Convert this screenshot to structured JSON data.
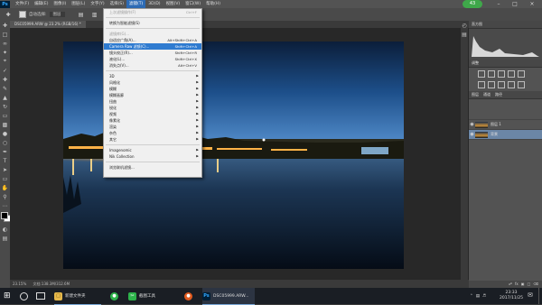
{
  "app": {
    "logo": "Ps"
  },
  "menubar": {
    "items": [
      "文件(F)",
      "编辑(E)",
      "图像(I)",
      "图层(L)",
      "文字(Y)",
      "选择(S)",
      "滤镜(T)",
      "3D(D)",
      "视图(V)",
      "窗口(W)",
      "帮助(H)"
    ],
    "active_index": 6
  },
  "optbar": {
    "auto_select_label": "自动选择:",
    "layer_value": "图层"
  },
  "document": {
    "tab": "DSC05999.ARW @ 23.2% (RGB/16) *",
    "zoom": "23.15%",
    "doc_info": "文档:138.3M/312.6M"
  },
  "badge": {
    "value": "43"
  },
  "filter_menu": {
    "items": [
      {
        "label": "上次滤镜操作(F)",
        "shortcut": "Ctrl+F",
        "disabled": true
      },
      {
        "sep": true
      },
      {
        "label": "转换为智能滤镜(S)"
      },
      {
        "sep": true
      },
      {
        "label": "滤镜库(G)...",
        "disabled": true
      },
      {
        "label": "自适应广角(A)...",
        "shortcut": "Alt+Shift+Ctrl+A"
      },
      {
        "label": "Camera Raw 滤镜(C)...",
        "shortcut": "Shift+Ctrl+A",
        "highlight": true
      },
      {
        "label": "镜头校正(R)...",
        "shortcut": "Shift+Ctrl+R"
      },
      {
        "label": "液化(L)...",
        "shortcut": "Shift+Ctrl+X"
      },
      {
        "label": "消失点(V)...",
        "shortcut": "Alt+Ctrl+V"
      },
      {
        "sep": true
      },
      {
        "label": "3D",
        "sub": true
      },
      {
        "label": "风格化",
        "sub": true
      },
      {
        "label": "模糊",
        "sub": true
      },
      {
        "label": "模糊画廊",
        "sub": true
      },
      {
        "label": "扭曲",
        "sub": true
      },
      {
        "label": "锐化",
        "sub": true
      },
      {
        "label": "视频",
        "sub": true
      },
      {
        "label": "像素化",
        "sub": true
      },
      {
        "label": "渲染",
        "sub": true
      },
      {
        "label": "杂色",
        "sub": true
      },
      {
        "label": "其它",
        "sub": true
      },
      {
        "sep": true
      },
      {
        "label": "Imagenomic",
        "sub": true
      },
      {
        "label": "Nik Collection",
        "sub": true
      },
      {
        "sep": true
      },
      {
        "label": "浏览联机滤镜..."
      }
    ]
  },
  "panels": {
    "histogram_tab": "直方图",
    "adjust_tab": "调整",
    "layers_tabs": [
      "图层",
      "通道",
      "路径"
    ],
    "layers": [
      {
        "name": "图层 1",
        "selected": false
      },
      {
        "name": "背景",
        "selected": true
      }
    ]
  },
  "taskbar": {
    "items": [
      "新建文件夹",
      "截图工具",
      "DSC05999.ARW..."
    ],
    "time": "23:33",
    "date": "2017/11/25"
  },
  "colors": {
    "menu_highlight": "#2f7bd0",
    "badge": "#3fa84a"
  }
}
